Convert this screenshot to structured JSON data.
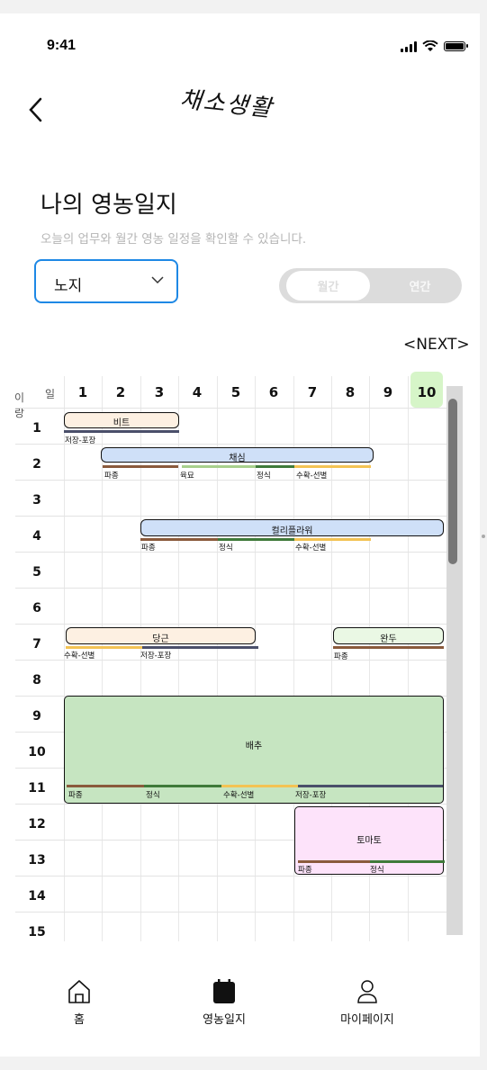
{
  "status": {
    "time": "9:41"
  },
  "header": {
    "title": "채소생활"
  },
  "page": {
    "heading": "나의 영농일지",
    "subtitle": "오늘의 업무와 월간 영농 일정을 확인할 수 있습니다.",
    "filter_value": "노지",
    "toggle": {
      "left": "월간",
      "right": "연간"
    },
    "next_label": "<NEXT>"
  },
  "calendar": {
    "corner_row_label": "이랑",
    "corner_day_label": "일",
    "days": [
      "1",
      "2",
      "3",
      "4",
      "5",
      "6",
      "7",
      "8",
      "9",
      "10"
    ],
    "highlight_day": "10",
    "rows": [
      "1",
      "2",
      "3",
      "4",
      "5",
      "6",
      "7",
      "8",
      "9",
      "10",
      "11",
      "12",
      "13",
      "14",
      "15"
    ],
    "crops": {
      "beet": "비트",
      "cabbage_leaf": "채심",
      "cauliflower": "컬리플라워",
      "carrot": "당근",
      "pea": "완두",
      "napa": "배추",
      "tomato": "토마토"
    },
    "stages": {
      "storage": "저장-포장",
      "sow": "파종",
      "seedling": "육묘",
      "plant": "정식",
      "harvest": "수확-선별"
    },
    "stage_colors": {
      "sow": "#8a5a3c",
      "seedling": "#a8d08d",
      "plant": "#3f7a3a",
      "harvest": "#f3c354",
      "storage": "#4a4f6a"
    }
  },
  "nav": {
    "home": "홈",
    "diary": "영농일지",
    "mypage": "마이페이지"
  }
}
